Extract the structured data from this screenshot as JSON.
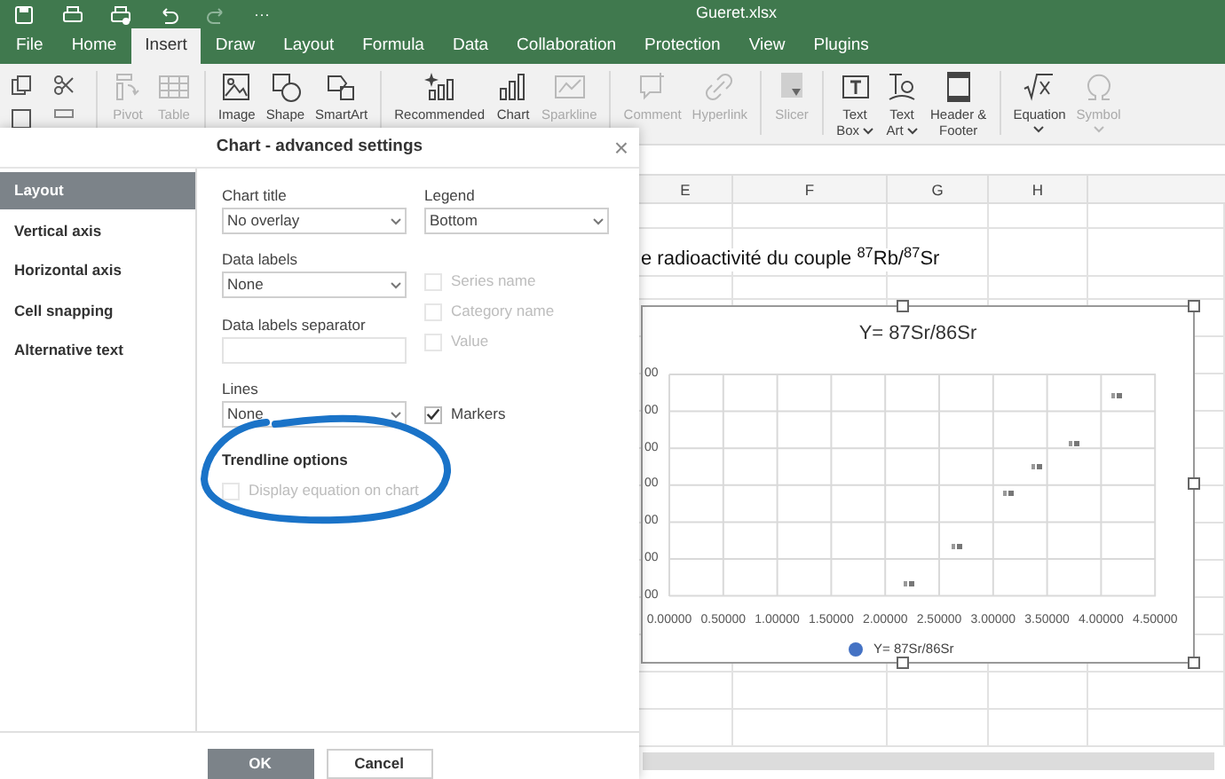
{
  "quick_access": {
    "more": "···"
  },
  "window": {
    "title": "Gueret.xlsx"
  },
  "tabs": [
    {
      "label": "File",
      "selected": false
    },
    {
      "label": "Home",
      "selected": false
    },
    {
      "label": "Insert",
      "selected": true
    },
    {
      "label": "Draw",
      "selected": false
    },
    {
      "label": "Layout",
      "selected": false
    },
    {
      "label": "Formula",
      "selected": false
    },
    {
      "label": "Data",
      "selected": false
    },
    {
      "label": "Collaboration",
      "selected": false
    },
    {
      "label": "Protection",
      "selected": false
    },
    {
      "label": "View",
      "selected": false
    },
    {
      "label": "Plugins",
      "selected": false
    }
  ],
  "toolbar": [
    {
      "items": [
        {
          "label": "Pivot",
          "disabled": true
        },
        {
          "label": "Table",
          "disabled": true
        }
      ]
    },
    {
      "items": [
        {
          "label": "Image",
          "disabled": false
        },
        {
          "label": "Shape",
          "disabled": false
        },
        {
          "label": "SmartArt",
          "disabled": false
        }
      ]
    },
    {
      "items": [
        {
          "label": "Recommended",
          "disabled": false
        },
        {
          "label": "Chart",
          "disabled": false
        },
        {
          "label": "Sparkline",
          "disabled": true
        }
      ]
    },
    {
      "items": [
        {
          "label": "Comment",
          "disabled": true
        },
        {
          "label": "Hyperlink",
          "disabled": true
        }
      ]
    },
    {
      "items": [
        {
          "label": "Slicer",
          "disabled": true
        }
      ]
    },
    {
      "items": [
        {
          "label": "Text",
          "label2": "Box",
          "dropdown": true,
          "disabled": false
        },
        {
          "label": "Text",
          "label2": "Art",
          "dropdown": true,
          "disabled": false
        },
        {
          "label": "Header &",
          "label2": "Footer",
          "dropdown": false,
          "disabled": false
        }
      ]
    },
    {
      "items": [
        {
          "label": "Equation",
          "dropdown": true,
          "disabled": false
        },
        {
          "label": "Symbol",
          "dropdown": true,
          "disabled": true
        }
      ]
    }
  ],
  "sheet": {
    "columns": [
      "E",
      "F",
      "G",
      "H"
    ],
    "caption": "e radioactivité du couple $^{87}$Rb/$^{87}$Sr",
    "chart": {
      "title": "Y= 87Sr/86Sr",
      "selected": true,
      "y_tick_labels": [
        "00",
        "00",
        "00",
        "00",
        "00",
        "00",
        "00"
      ],
      "x_tick_labels": [
        "0.00000",
        "0.50000",
        "1.00000",
        "1.50000",
        "2.00000",
        "2.50000",
        "3.00000",
        "3.50000",
        "4.00000",
        "4.50000"
      ],
      "legend": "Y= 87Sr/86Sr"
    }
  },
  "dialog": {
    "title": "Chart - advanced settings",
    "close": "×",
    "sidebar": [
      {
        "label": "Layout",
        "selected": true
      },
      {
        "label": "Vertical axis",
        "selected": false
      },
      {
        "label": "Horizontal axis",
        "selected": false
      },
      {
        "label": "Cell snapping",
        "selected": false
      },
      {
        "label": "Alternative text",
        "selected": false
      }
    ],
    "rows": [
      {
        "columns": [
          [
            {
              "kind": "select",
              "label": "Chart title",
              "value": "No overlay"
            }
          ],
          [
            {
              "kind": "select",
              "label": "Legend",
              "value": "Bottom"
            }
          ]
        ]
      },
      {
        "columns": [
          [
            {
              "kind": "select",
              "label": "Data labels",
              "value": "None"
            },
            {
              "kind": "input",
              "label": "Data labels separator"
            }
          ],
          [
            {
              "kind": "checkbox",
              "label": "Series name",
              "checked": false,
              "disabled": true
            },
            {
              "kind": "checkbox",
              "label": "Category name",
              "checked": false,
              "disabled": true
            },
            {
              "kind": "checkbox",
              "label": "Value",
              "checked": false,
              "disabled": true
            }
          ]
        ]
      },
      {
        "columns": [
          [
            {
              "kind": "select",
              "label": "Lines",
              "value": "None"
            }
          ],
          [
            {
              "kind": "checkbox",
              "label": "Markers",
              "checked": true,
              "disabled": false
            }
          ]
        ]
      },
      {
        "columns": [
          [
            {
              "kind": "heading",
              "label": "Trendline options"
            },
            {
              "kind": "checkbox",
              "label": "Display equation on chart",
              "checked": false,
              "disabled": true
            }
          ]
        ]
      }
    ],
    "buttons": [
      {
        "label": "OK",
        "primary": true
      },
      {
        "label": "Cancel",
        "primary": false
      }
    ]
  }
}
